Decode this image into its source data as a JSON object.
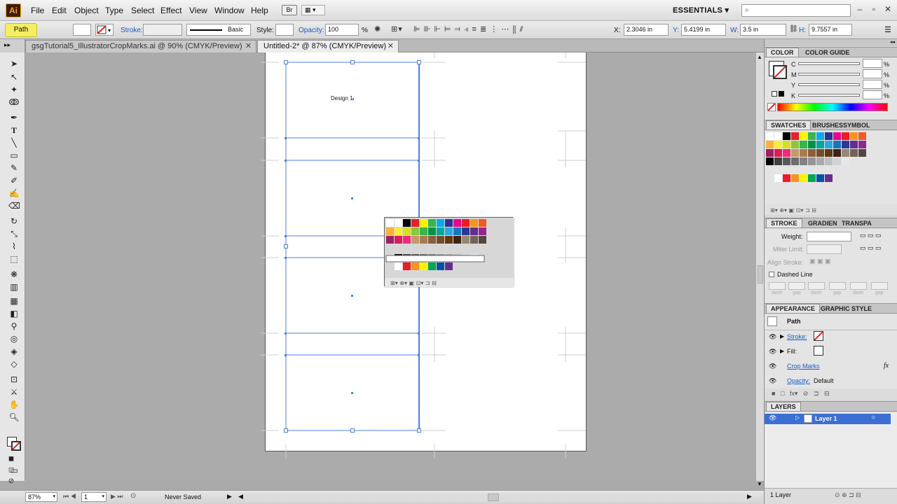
{
  "app": {
    "logo": "Ai"
  },
  "menu": [
    "File",
    "Edit",
    "Object",
    "Type",
    "Select",
    "Effect",
    "View",
    "Window",
    "Help"
  ],
  "menu_extra": {
    "bridge": "Br",
    "arrange": "▦ ▾"
  },
  "workspace": {
    "label": "ESSENTIALS",
    "arrow": "▾"
  },
  "search": {
    "icon": "search-icon",
    "placeholder": "⌕"
  },
  "window_controls": {
    "minimize": "–",
    "restore": "▫",
    "close": "✕"
  },
  "control": {
    "selection_type": "Path",
    "stroke_label": "Stroke:",
    "stroke_style": "Basic",
    "style_label": "Style:",
    "opacity_label": "Opacity:",
    "opacity_value": "100",
    "opacity_unit": "%",
    "x_label": "X:",
    "x_value": "2.3046 in",
    "y_label": "Y:",
    "y_value": "5.4199 in",
    "w_label": "W:",
    "w_value": "3.5 in",
    "h_label": "H:",
    "h_value": "9.7557 in"
  },
  "tabs": [
    {
      "label": "gsgTutorial5_IllustratorCropMarks.ai @ 90% (CMYK/Preview)",
      "close": "✕"
    },
    {
      "label": "Untitled-2* @ 87% (CMYK/Preview)",
      "close": "✕"
    }
  ],
  "canvas": {
    "design_label": "Design 1"
  },
  "color_panel": {
    "tabs": [
      "COLOR",
      "COLOR GUIDE"
    ],
    "channels": [
      {
        "label": "C",
        "unit": "%"
      },
      {
        "label": "M",
        "unit": "%"
      },
      {
        "label": "Y",
        "unit": "%"
      },
      {
        "label": "K",
        "unit": "%"
      }
    ]
  },
  "swatches_panel": {
    "tabs": [
      "SWATCHES",
      "BRUSHES",
      "SYMBOL"
    ]
  },
  "stroke_panel": {
    "tabs": [
      "STROKE",
      "GRADIEN",
      "TRANSPA"
    ],
    "weight_label": "Weight:",
    "miter_label": "Miter Limit:",
    "align_label": "Align Stroke:",
    "dashed_label": "Dashed Line",
    "dash_labels": [
      "dash",
      "gap",
      "dash",
      "gap",
      "dash",
      "gap"
    ]
  },
  "appearance_panel": {
    "tabs": [
      "APPEARANCE",
      "GRAPHIC STYLE"
    ],
    "title": "Path",
    "rows": [
      {
        "label": "Stroke:"
      },
      {
        "label": "Fill:"
      },
      {
        "label": "Crop Marks",
        "fx": "fx"
      },
      {
        "label": "Opacity:",
        "value": "Default"
      }
    ]
  },
  "layers_panel": {
    "title": "LAYERS",
    "layer": "Layer 1",
    "footer": "1 Layer"
  },
  "status": {
    "zoom": "87%",
    "page": "1",
    "state": "Never Saved"
  },
  "colors": {
    "accent": "#3c6ed8",
    "selection": "#4e7fdc",
    "layer_highlight": "#3b6fd4",
    "path_badge": "#f4ee62"
  }
}
